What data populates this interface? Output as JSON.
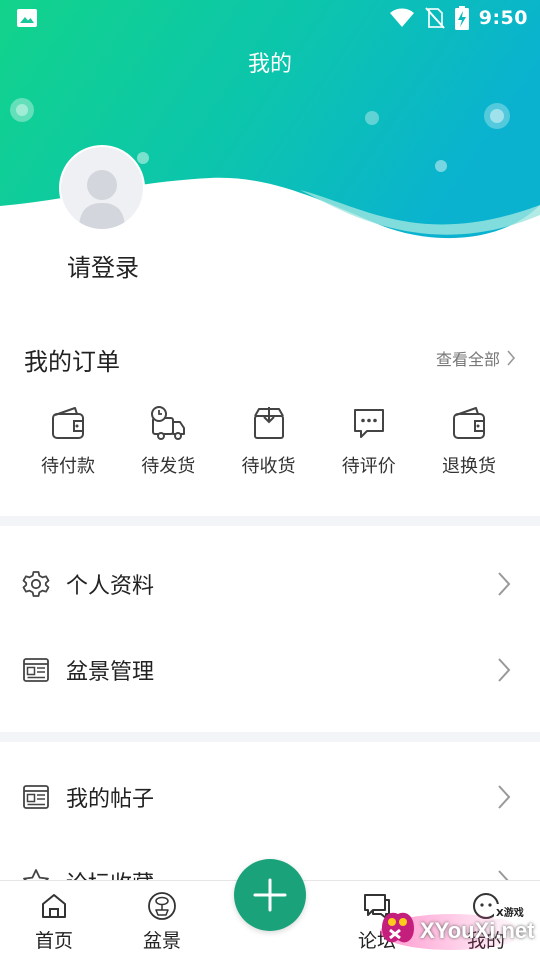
{
  "status_bar": {
    "time": "9:50",
    "left_icon": "image-icon",
    "right_icons": [
      "wifi-icon",
      "no-sim-icon",
      "battery-charging-icon"
    ]
  },
  "header": {
    "title": "我的",
    "gradient": [
      "#15d18c",
      "#0ab3cf"
    ]
  },
  "profile": {
    "login_text": "请登录",
    "avatar_icon": "default-avatar-icon"
  },
  "orders": {
    "title": "我的订单",
    "view_all": "查看全部",
    "items": [
      {
        "label": "待付款",
        "icon": "wallet-icon"
      },
      {
        "label": "待发货",
        "icon": "truck-icon"
      },
      {
        "label": "待收货",
        "icon": "inbox-icon"
      },
      {
        "label": "待评价",
        "icon": "comment-icon"
      },
      {
        "label": "退换货",
        "icon": "wallet-icon"
      }
    ]
  },
  "menu": {
    "items": [
      {
        "label": "个人资料",
        "icon": "gear-icon"
      },
      {
        "label": "盆景管理",
        "icon": "id-card-icon"
      },
      {
        "label": "我的帖子",
        "icon": "id-card-icon"
      },
      {
        "label": "论坛收藏",
        "icon": "star-icon"
      }
    ]
  },
  "tabbar": {
    "tabs": [
      {
        "label": "首页",
        "icon": "home-icon"
      },
      {
        "label": "盆景",
        "icon": "bonsai-icon"
      },
      {
        "label": "论坛",
        "icon": "chat-icon"
      },
      {
        "label": "我的",
        "icon": "profile-icon"
      }
    ],
    "center_button_icon": "plus-icon",
    "accent": "#1aa37a"
  },
  "watermark": {
    "brand": "XYouXi.net",
    "top_text": "X游戏"
  }
}
